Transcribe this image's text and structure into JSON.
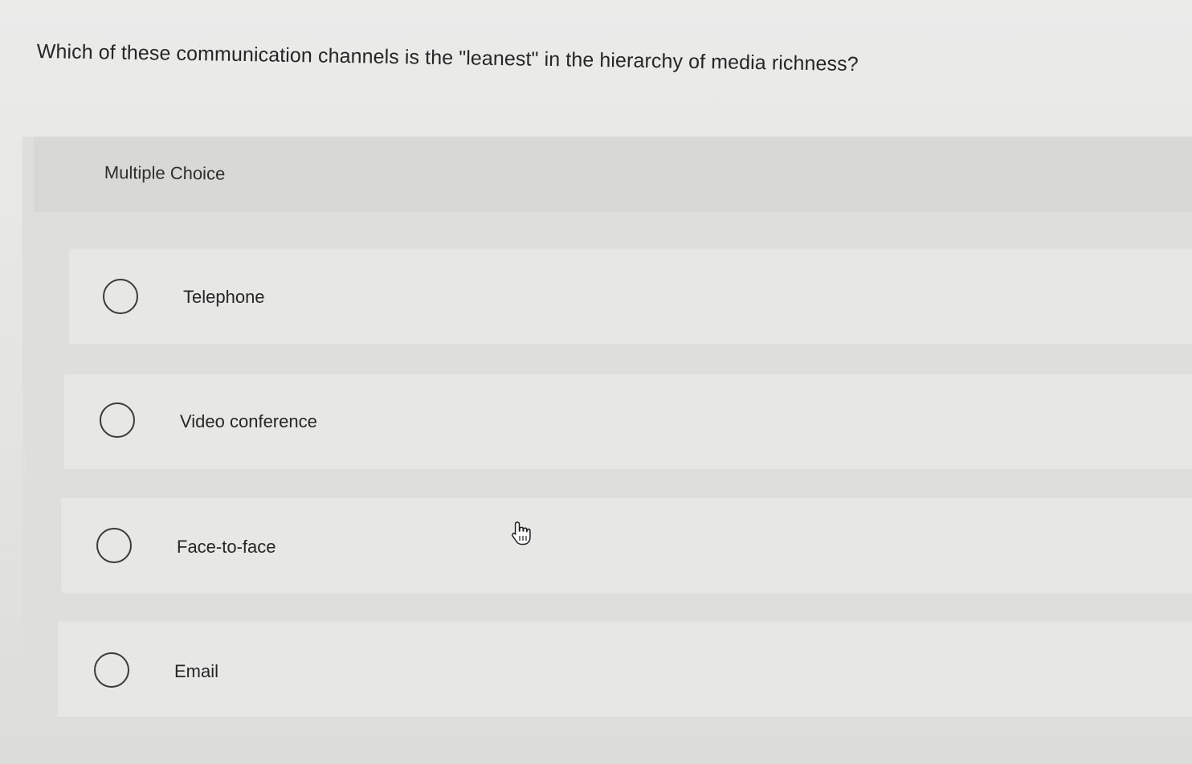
{
  "question": {
    "text": "Which of these communication channels is the \"leanest\" in the hierarchy of media richness?"
  },
  "multiple_choice": {
    "label": "Multiple Choice",
    "options": [
      {
        "label": "Telephone",
        "selected": false
      },
      {
        "label": "Video conference",
        "selected": false
      },
      {
        "label": "Face-to-face",
        "selected": false
      },
      {
        "label": "Email",
        "selected": false
      }
    ]
  },
  "cursor": {
    "icon": "hand-pointer-icon"
  }
}
